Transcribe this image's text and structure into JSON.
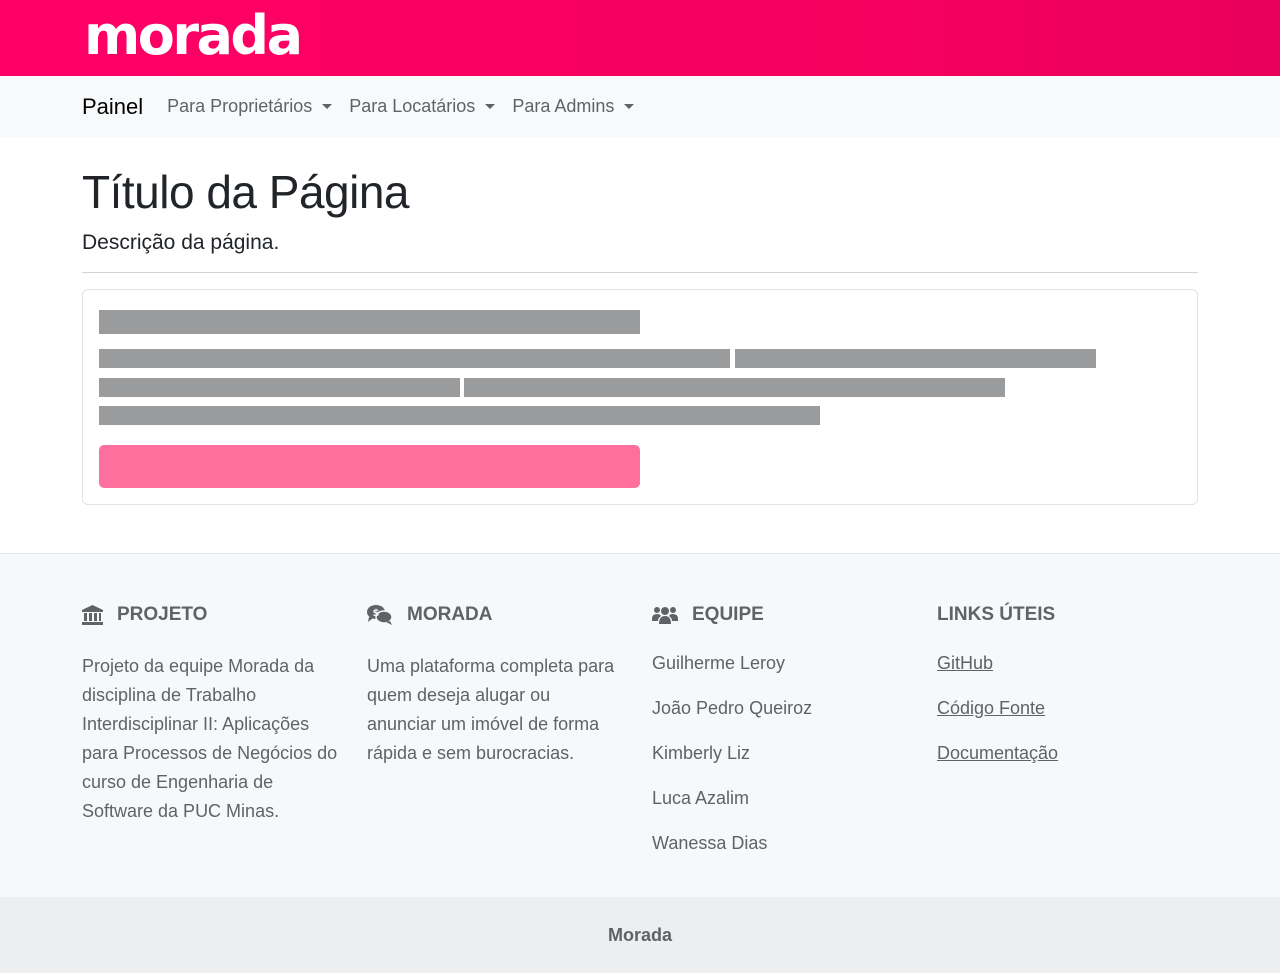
{
  "header": {
    "logo_text": "morada",
    "brand_color": "#ff0066"
  },
  "nav": {
    "brand": "Painel",
    "items": [
      {
        "label": "Para Proprietários"
      },
      {
        "label": "Para Locatários"
      },
      {
        "label": "Para Admins"
      }
    ]
  },
  "page": {
    "title": "Título da Página",
    "description": "Descrição da página."
  },
  "footer": {
    "projeto": {
      "heading": "PROJETO",
      "icon": "bank-icon",
      "text": "Projeto da equipe Morada da disciplina de Trabalho Interdisciplinar II: Aplicações para Processos de Negócios do curso de Engenharia de Software da PUC Minas."
    },
    "morada": {
      "heading": "MORADA",
      "icon": "comments-dollar-icon",
      "text": "Uma plataforma completa para quem deseja alugar ou anunciar um imóvel de forma rápida e sem burocracias."
    },
    "equipe": {
      "heading": "EQUIPE",
      "icon": "users-icon",
      "members": [
        "Guilherme Leroy",
        "João Pedro Queiroz",
        "Kimberly Liz",
        "Luca Azalim",
        "Wanessa Dias"
      ]
    },
    "links": {
      "heading": "LINKS ÚTEIS",
      "items": [
        "GitHub",
        "Código Fonte",
        "Documentação"
      ]
    }
  },
  "bottom": {
    "label": "Morada"
  }
}
